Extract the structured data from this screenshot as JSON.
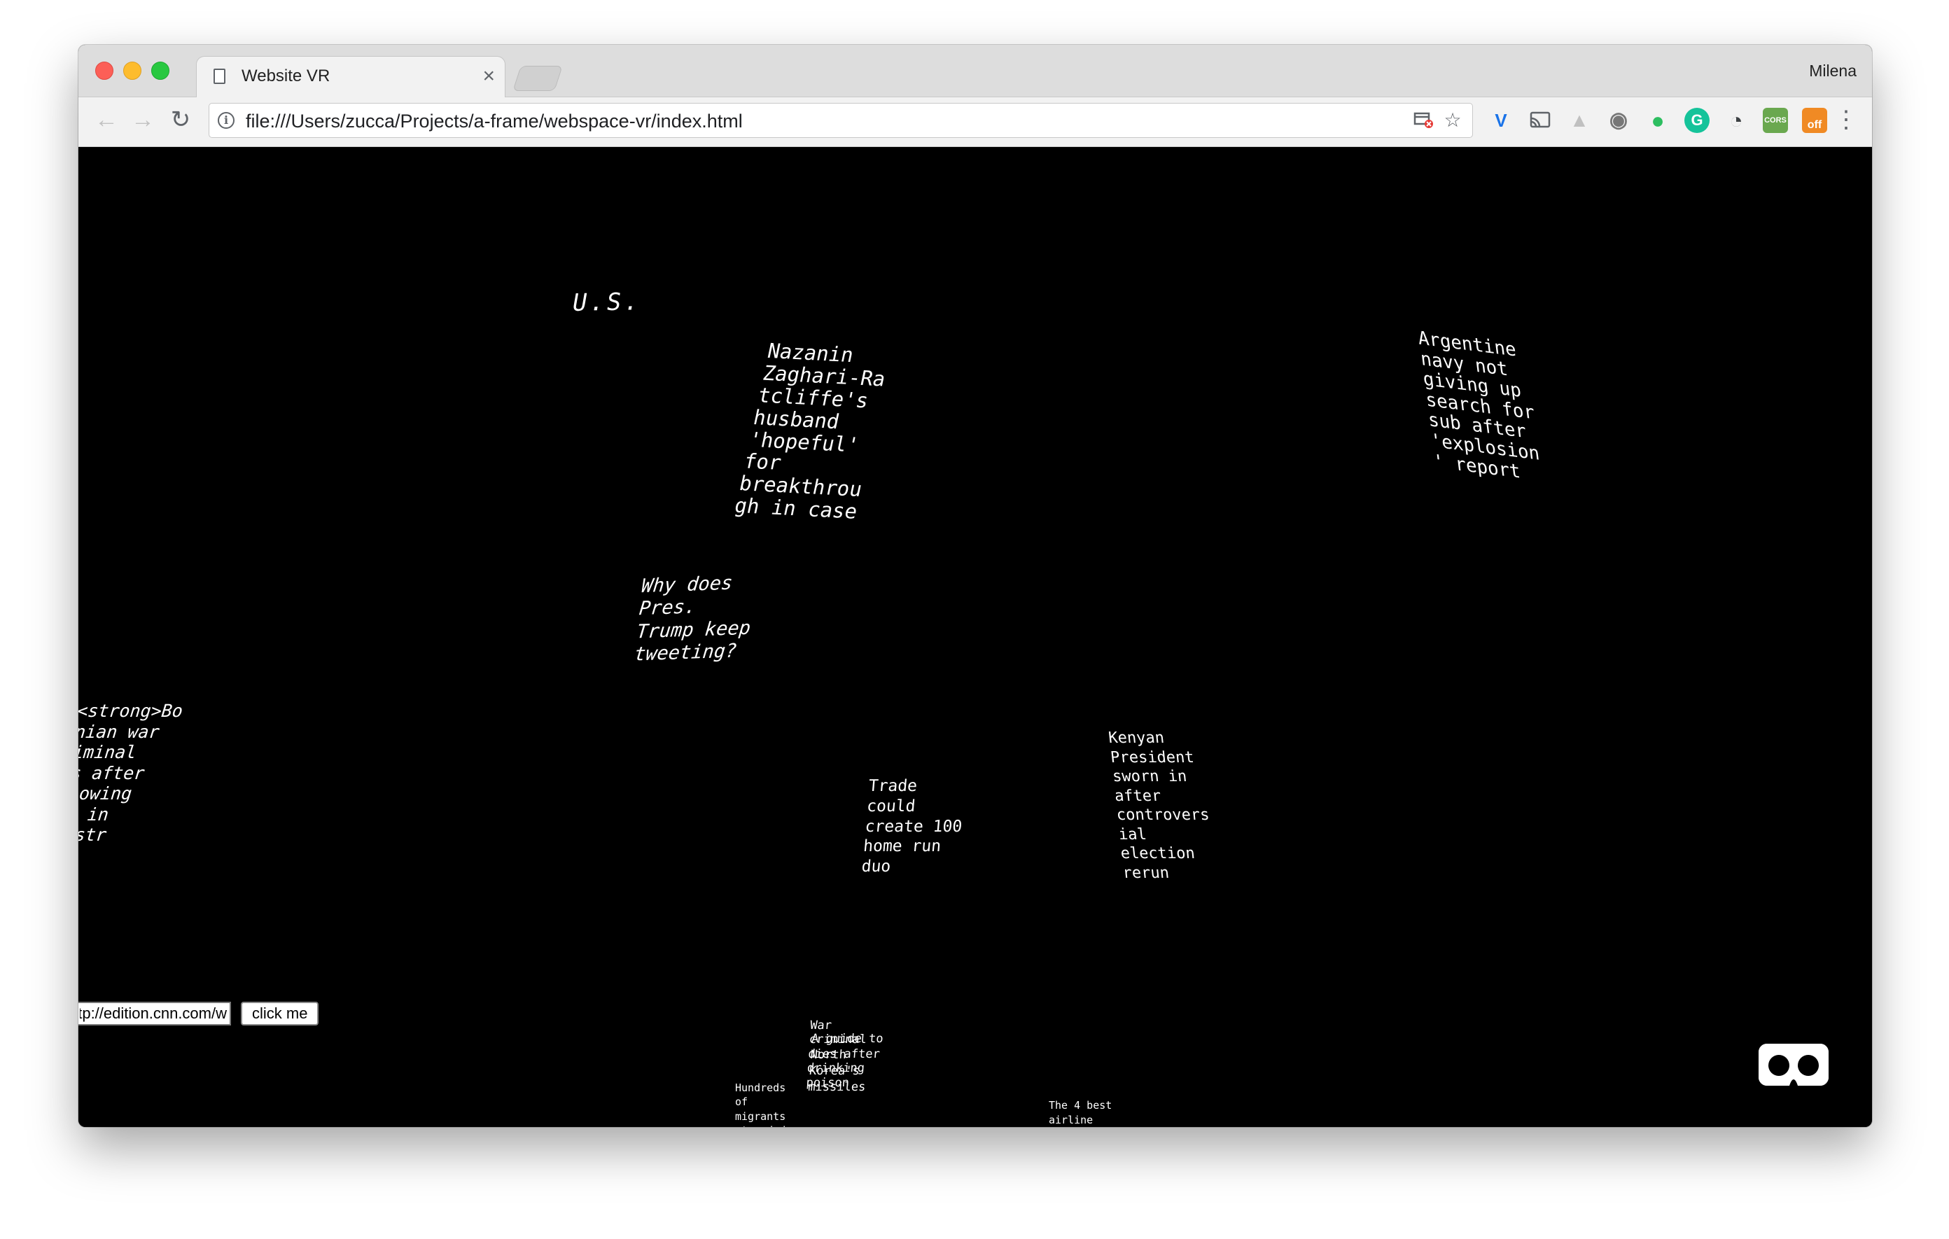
{
  "browser": {
    "tab_title": "Website VR",
    "tab_close": "×",
    "profile_name": "Milena",
    "url": "file:///Users/zucca/Projects/a-frame/webspace-vr/index.html",
    "info_icon_glyph": "i",
    "nav": {
      "back": "←",
      "forward": "→",
      "reload": "↻"
    },
    "omnibox_icons": [
      "cast-blocked-icon",
      "star-icon"
    ],
    "extensions": [
      {
        "name": "vimium-icon",
        "glyph": "V",
        "color": "#1a73e8"
      },
      {
        "name": "cast-icon",
        "glyph": "▭",
        "color": "#9aa0a6"
      },
      {
        "name": "drive-icon",
        "glyph": "▲",
        "color": "#b8b8b8"
      },
      {
        "name": "film-icon",
        "glyph": "◉",
        "color": "#8a8a8a"
      },
      {
        "name": "evernote-icon",
        "glyph": "●",
        "color": "#2dbe60"
      },
      {
        "name": "grammarly-icon",
        "glyph": "G",
        "color": "#15c39a"
      },
      {
        "name": "clock-icon",
        "glyph": "◔",
        "color": "#3c4043"
      },
      {
        "name": "cors-icon",
        "glyph": "CORS",
        "color": "#6aa84f"
      },
      {
        "name": "off-toggle-icon",
        "glyph": "off",
        "color": "#f08a24"
      }
    ],
    "menu_glyph": "⋮"
  },
  "scene": {
    "headlines": [
      {
        "id": "us",
        "text": "U.S."
      },
      {
        "id": "nazanin",
        "text": "Nazanin\nZaghari-Ra\ntcliffe's\nhusband\n'hopeful'\nfor\nbreakthrou\ngh in case"
      },
      {
        "id": "argentine",
        "text": "Argentine\nnavy not\ngiving up\nsearch for\nsub after\n'explosion\n' report"
      },
      {
        "id": "trump",
        "text": "Why does\nPres.\nTrump keep\ntweeting?"
      },
      {
        "id": "bosnian",
        "text": "<strong>Bo\nnian war\niminal\ns after\nlowing\nn in\n/str"
      },
      {
        "id": "trade",
        "text": "Trade\ncould\ncreate 100\nhome run\nduo"
      },
      {
        "id": "kenyan",
        "text": "Kenyan\nPresident\nsworn in\nafter\ncontrovers\nial\nelection\nrerun"
      },
      {
        "id": "war-criminal",
        "text": "War\ncriminal\ndies after\ndrinking\npoison"
      },
      {
        "id": "guide-korea",
        "text": "A guide to\nNorth\nKorea's\nmissiles"
      },
      {
        "id": "migrants",
        "text": "Hundreds\nof\nmigrants\nstranded"
      },
      {
        "id": "airline",
        "text": "The 4 best\nairline"
      }
    ],
    "url_input_value": "http://edition.cnn.com/w",
    "click_button_label": "click me",
    "vr_button": "vr-mode-icon"
  }
}
